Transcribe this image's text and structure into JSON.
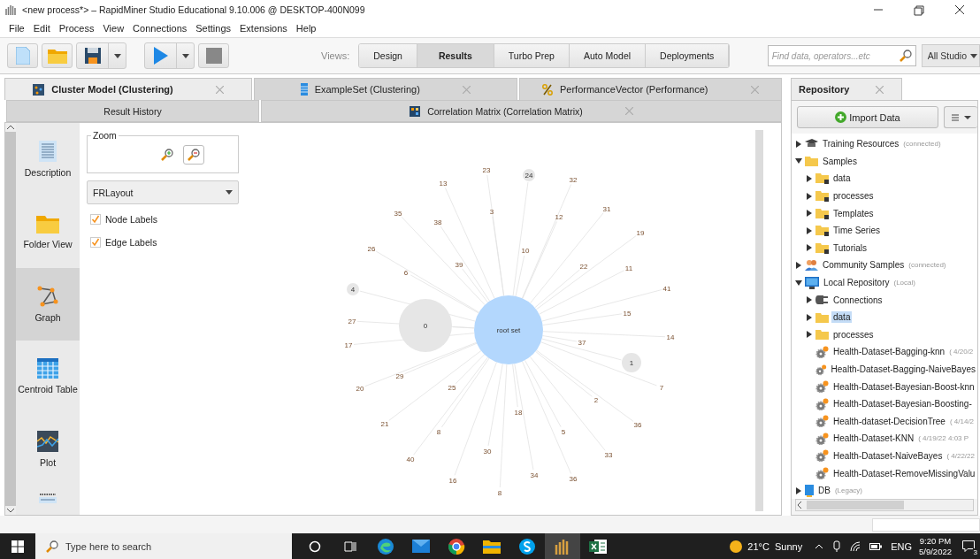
{
  "window": {
    "title": "<new process*> – RapidMiner Studio Educational 9.10.006 @ DESKTOP-400N099"
  },
  "menu": [
    "File",
    "Edit",
    "Process",
    "View",
    "Connections",
    "Settings",
    "Extensions",
    "Help"
  ],
  "toolbar": {
    "views_label": "Views:",
    "views": [
      {
        "label": "Design",
        "selected": false
      },
      {
        "label": "Results",
        "selected": true
      },
      {
        "label": "Turbo Prep",
        "selected": false
      },
      {
        "label": "Auto Model",
        "selected": false
      },
      {
        "label": "Deployments",
        "selected": false
      }
    ],
    "search": {
      "placeholder": "Find data, operators...etc"
    },
    "scope": "All Studio"
  },
  "result_tabs": [
    {
      "label": "Cluster Model (Clustering)",
      "kind": "model",
      "selected": true
    },
    {
      "label": "ExampleSet (Clustering)",
      "kind": "table",
      "selected": false
    },
    {
      "label": "PerformanceVector (Performance)",
      "kind": "percent",
      "selected": false
    }
  ],
  "history_tabs": [
    {
      "label": "Result History",
      "kind": "history",
      "selected": false
    },
    {
      "label": "Correlation Matrix (Correlation Matrix)",
      "kind": "matrix",
      "selected": false
    }
  ],
  "side_nav": [
    {
      "label": "Description",
      "kind": "description",
      "selected": false
    },
    {
      "label": "Folder View",
      "kind": "folder",
      "selected": false
    },
    {
      "label": "Graph",
      "kind": "graph",
      "selected": true
    },
    {
      "label": "Centroid Table",
      "kind": "table",
      "selected": false
    },
    {
      "label": "Plot",
      "kind": "plot",
      "selected": false
    },
    {
      "kind": "list",
      "selected": false
    }
  ],
  "options": {
    "zoom_title": "Zoom",
    "layout": "FRLayout",
    "checkboxes": [
      {
        "label": "Node Labels",
        "checked": true
      },
      {
        "label": "Edge Labels",
        "checked": true
      }
    ]
  },
  "graph": {
    "root": "root set",
    "nodes": [
      {
        "label": "23",
        "kind": "leaf"
      },
      {
        "label": "24",
        "kind": "small"
      },
      {
        "label": "32",
        "kind": "leaf"
      },
      {
        "label": "13",
        "kind": "leaf"
      },
      {
        "label": "3",
        "kind": "leaf"
      },
      {
        "label": "31",
        "kind": "leaf"
      },
      {
        "label": "12",
        "kind": "leaf"
      },
      {
        "label": "35",
        "kind": "leaf"
      },
      {
        "label": "38",
        "kind": "leaf"
      },
      {
        "label": "19",
        "kind": "leaf"
      },
      {
        "label": "10",
        "kind": "leaf"
      },
      {
        "label": "26",
        "kind": "leaf"
      },
      {
        "label": "39",
        "kind": "leaf"
      },
      {
        "label": "22",
        "kind": "leaf"
      },
      {
        "label": "11",
        "kind": "leaf"
      },
      {
        "label": "6",
        "kind": "leaf"
      },
      {
        "label": "4",
        "kind": "small"
      },
      {
        "label": "41",
        "kind": "leaf"
      },
      {
        "label": "15",
        "kind": "leaf"
      },
      {
        "label": "27",
        "kind": "leaf"
      },
      {
        "label": "0",
        "kind": "big"
      },
      {
        "label": "14",
        "kind": "leaf"
      },
      {
        "label": "17",
        "kind": "leaf"
      },
      {
        "label": "37",
        "kind": "leaf"
      },
      {
        "label": "1",
        "kind": "medium"
      },
      {
        "label": "29",
        "kind": "leaf"
      },
      {
        "label": "20",
        "kind": "leaf"
      },
      {
        "label": "25",
        "kind": "leaf"
      },
      {
        "label": "7",
        "kind": "leaf"
      },
      {
        "label": "2",
        "kind": "leaf"
      },
      {
        "label": "18",
        "kind": "leaf"
      },
      {
        "label": "36",
        "kind": "leaf"
      },
      {
        "label": "21",
        "kind": "leaf"
      },
      {
        "label": "8",
        "kind": "leaf"
      },
      {
        "label": "5",
        "kind": "leaf"
      },
      {
        "label": "30",
        "kind": "leaf"
      },
      {
        "label": "33",
        "kind": "leaf"
      },
      {
        "label": "40",
        "kind": "leaf"
      },
      {
        "label": "34",
        "kind": "leaf"
      },
      {
        "label": "36",
        "kind": "leaf"
      },
      {
        "label": "16",
        "kind": "leaf"
      },
      {
        "label": "8",
        "kind": "leaf"
      }
    ]
  },
  "repository": {
    "tab": "Repository",
    "import_button": "Import Data",
    "tree": [
      {
        "label": "Training Resources",
        "note": "(connected)",
        "kind": "training",
        "expanded": false,
        "selected": false
      },
      {
        "label": "Samples",
        "kind": "folder",
        "expanded": true,
        "selected": false,
        "children": [
          {
            "label": "data",
            "kind": "locked",
            "expanded": false,
            "selected": false
          },
          {
            "label": "processes",
            "kind": "locked",
            "expanded": false,
            "selected": false
          },
          {
            "label": "Templates",
            "kind": "locked",
            "expanded": false,
            "selected": false
          },
          {
            "label": "Time Series",
            "kind": "locked",
            "expanded": false,
            "selected": false
          },
          {
            "label": "Tutorials",
            "kind": "locked",
            "expanded": false,
            "selected": false
          }
        ]
      },
      {
        "label": "Community Samples",
        "note": "(connected)",
        "kind": "community",
        "expanded": false,
        "selected": false
      },
      {
        "label": "Local Repository",
        "note": "(Local)",
        "kind": "local",
        "expanded": true,
        "selected": false,
        "children": [
          {
            "label": "Connections",
            "kind": "connections",
            "expanded": false,
            "selected": false
          },
          {
            "label": "data",
            "kind": "folder",
            "expanded": false,
            "selected": true
          },
          {
            "label": "processes",
            "kind": "folder",
            "expanded": false,
            "selected": false
          },
          {
            "label": "Health-Dataset-Bagging-knn",
            "note": "( 4/20/2",
            "kind": "process",
            "selected": false
          },
          {
            "label": "Health-Dataset-Bagging-NaiveBayes",
            "kind": "process",
            "selected": false
          },
          {
            "label": "Health-Dataset-Bayesian-Boost-knn",
            "kind": "process",
            "selected": false
          },
          {
            "label": "Health-Dataset-Bayesian-Boosting-",
            "kind": "process",
            "selected": false
          },
          {
            "label": "Health-dataset-DecisionTree",
            "note": "( 4/14/2",
            "kind": "process",
            "selected": false
          },
          {
            "label": "Health-Dataset-KNN",
            "note": "( 4/19/22 4:03 P",
            "kind": "process",
            "selected": false
          },
          {
            "label": "Health-Dataset-NaiveBayes",
            "note": "( 4/22/22",
            "kind": "process",
            "selected": false
          },
          {
            "label": "Health-Dataset-RemoveMissingValu",
            "kind": "process",
            "selected": false
          }
        ]
      },
      {
        "label": "DB",
        "note": "(Legacy)",
        "kind": "db",
        "expanded": false,
        "selected": false
      }
    ]
  },
  "taskbar": {
    "search": {
      "placeholder": "Type here to search"
    },
    "weather": "21°C  Sunny",
    "language": "ENG",
    "time": "9:20 PM",
    "date": "5/9/2022",
    "notifications": "3"
  }
}
